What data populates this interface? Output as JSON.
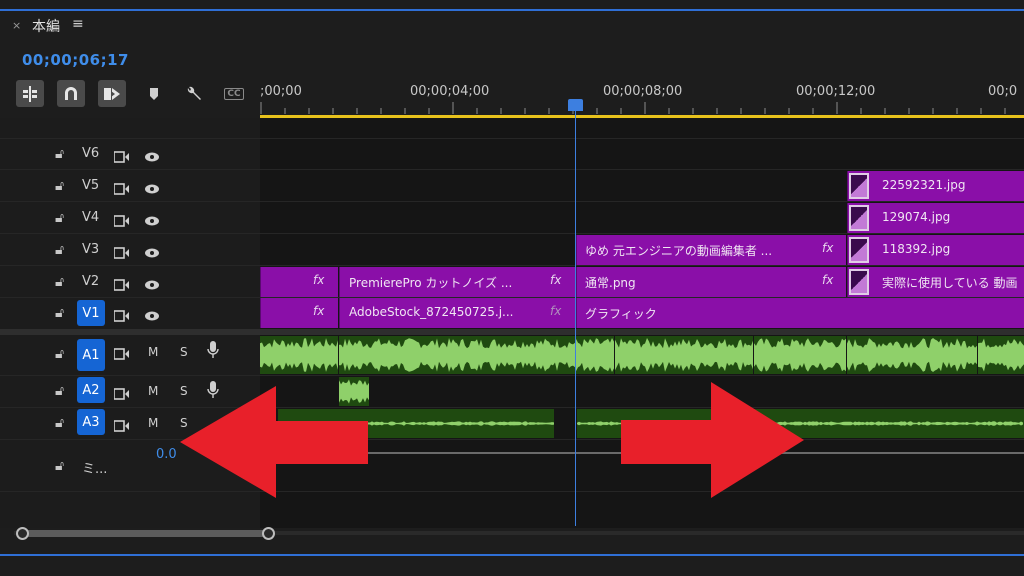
{
  "panel": {
    "close_glyph": "×",
    "title": "本編",
    "menu_glyph": "≡",
    "timecode": "00;00;06;17"
  },
  "toolbar": {
    "tools": [
      "insert-sequence-icon",
      "snap-magnet-icon",
      "linked-selection-icon",
      "add-marker-icon",
      "wrench-settings-icon",
      "captions-icon"
    ],
    "captions_label": "CC"
  },
  "ruler": {
    "labels": [
      ";00;00",
      "00;00;04;00",
      "00;00;08;00",
      "00;00;12;00",
      "00;0"
    ]
  },
  "tracks": {
    "video": [
      {
        "name": "V6",
        "targeted": false
      },
      {
        "name": "V5",
        "targeted": false
      },
      {
        "name": "V4",
        "targeted": false
      },
      {
        "name": "V3",
        "targeted": false
      },
      {
        "name": "V2",
        "targeted": false
      },
      {
        "name": "V1",
        "targeted": true
      }
    ],
    "audio": [
      {
        "name": "A1",
        "m": "M",
        "s": "S"
      },
      {
        "name": "A2",
        "m": "M",
        "s": "S"
      },
      {
        "name": "A3",
        "m": "M",
        "s": "S"
      }
    ],
    "mix": {
      "name": "ミ...",
      "value": "0.0"
    }
  },
  "clips": {
    "v5": "22592321.jpg",
    "v4": "129074.jpg",
    "v3_a": "ゆめ 元エンジニアの動画編集者 ...",
    "v3_b": "118392.jpg",
    "v2_a": "PremierePro カットノイズ ...",
    "v2_b": "通常.png",
    "v2_c": "実際に使用している 動画",
    "v1_a": "AdobeStock_872450725.j...",
    "v1_b": "グラフィック",
    "fx": "fx"
  },
  "colors": {
    "accent_blue": "#3f8dea",
    "video_clip": "#8a0fa8",
    "audio_clip": "#1f4a10",
    "waveform": "#8fd06a",
    "arrow_red": "#e8202a",
    "work_area": "#e8c21c"
  }
}
